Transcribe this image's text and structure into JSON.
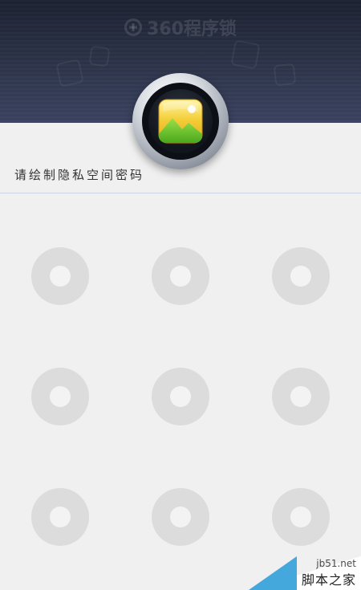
{
  "header": {
    "brand_text": "360程序锁",
    "colors": {
      "top": "#1c2131",
      "bottom": "#3a4260"
    }
  },
  "lock_icon": {
    "icon": "photo-gallery-icon"
  },
  "prompt": {
    "text": "请绘制隐私空间密码"
  },
  "pattern": {
    "rows": 3,
    "cols": 3,
    "dots": [
      {
        "id": 1
      },
      {
        "id": 2
      },
      {
        "id": 3
      },
      {
        "id": 4
      },
      {
        "id": 5
      },
      {
        "id": 6
      },
      {
        "id": 7
      },
      {
        "id": 8
      },
      {
        "id": 9
      }
    ],
    "dot_color": "#dcdcdc",
    "dot_center_color": "#f3f3f3"
  },
  "watermark": {
    "top_text": "jb51.net",
    "bottom_text": "脚本之家",
    "accent": "#45a8dd"
  }
}
